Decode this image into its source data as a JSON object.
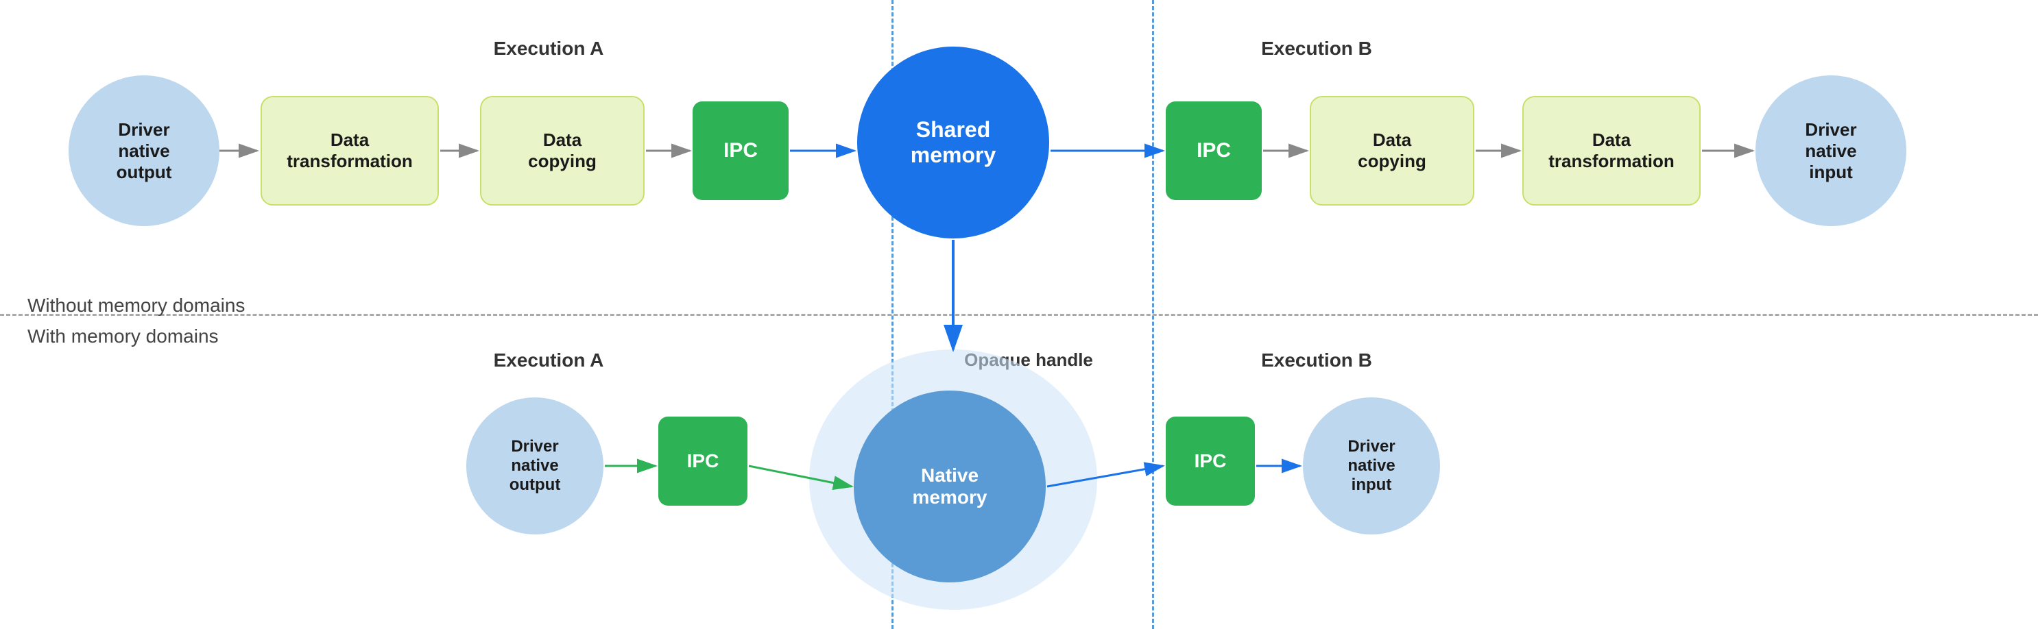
{
  "top_section_label": "Without memory domains",
  "bottom_section_label": "With memory domains",
  "exec_a_top_label": "Execution A",
  "exec_b_top_label": "Execution B",
  "exec_a_bottom_label": "Execution A",
  "exec_b_bottom_label": "Execution B",
  "opaque_handle_label": "Opaque handle",
  "top_row": {
    "driver_output": {
      "line1": "Driver",
      "line2": "native",
      "line3": "output"
    },
    "data_transform1": {
      "line1": "Data",
      "line2": "transformation"
    },
    "data_copying1": {
      "line1": "Data",
      "line2": "copying"
    },
    "ipc1": "IPC",
    "shared_memory": {
      "line1": "Shared",
      "line2": "memory"
    },
    "ipc2": "IPC",
    "data_copying2": {
      "line1": "Data",
      "line2": "copying"
    },
    "data_transform2": {
      "line1": "Data",
      "line2": "transformation"
    },
    "driver_input": {
      "line1": "Driver",
      "line2": "native",
      "line3": "input"
    }
  },
  "bottom_row": {
    "driver_output": {
      "line1": "Driver",
      "line2": "native",
      "line3": "output"
    },
    "ipc1": "IPC",
    "native_memory": {
      "line1": "Native",
      "line2": "memory"
    },
    "ipc2": "IPC",
    "driver_input": {
      "line1": "Driver",
      "line2": "native",
      "line3": "input"
    }
  },
  "colors": {
    "ipc_green": "#2db356",
    "shared_memory_blue": "#1a73e8",
    "native_memory_blue": "#1a73e8",
    "light_blue_circle": "#bdd7ee",
    "light_yellow_rect": "#e2f0b8",
    "arrow_color": "#555",
    "arrow_blue": "#1a73e8"
  }
}
